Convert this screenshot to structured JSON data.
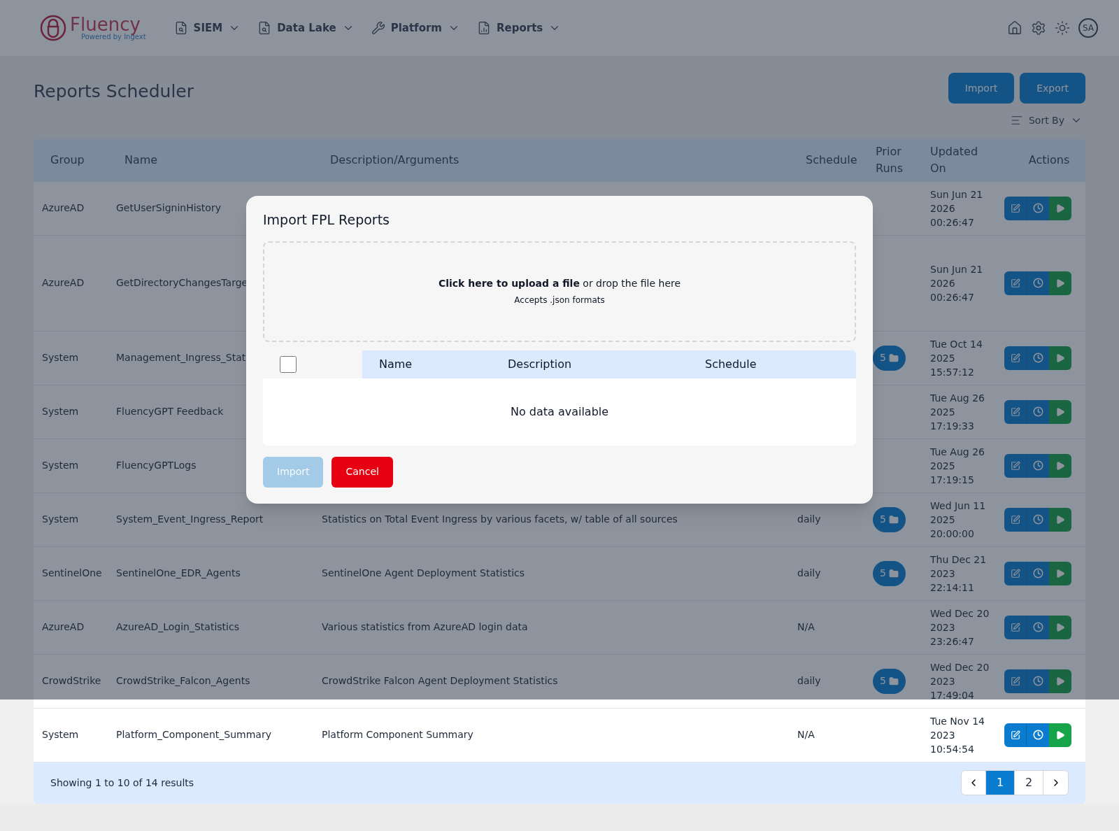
{
  "nav": {
    "logo": "Fluency",
    "logo_tagline": "Powered by Ingext",
    "menus": [
      {
        "label": "SIEM",
        "kind": "search"
      },
      {
        "label": "Data Lake",
        "kind": "search"
      },
      {
        "label": "Platform",
        "kind": "tool"
      },
      {
        "label": "Reports",
        "kind": "report"
      }
    ],
    "avatar": "SA"
  },
  "page": {
    "title": "Reports Scheduler",
    "buttons": [
      "Import",
      "Export"
    ],
    "sort": "Sort By"
  },
  "table": {
    "columns": [
      "Group",
      "Name",
      "Description/Arguments",
      "Schedule",
      "Prior Runs",
      "Updated On",
      "Actions"
    ],
    "rows": [
      {
        "group": "AzureAD",
        "name": "GetUserSigninHistory",
        "updated": "Sun Jun 21 2026 00:26:47"
      },
      {
        "group": "AzureAD",
        "name": "GetDirectoryChangesTarge",
        "updated": "Sun Jun 21 2026 00:26:47"
      },
      {
        "group": "System",
        "name": "Management_Ingress_Stat",
        "prior_runs": "5",
        "updated": "Tue Oct 14 2025 15:57:12"
      },
      {
        "group": "System",
        "name": "FluencyGPT Feedback",
        "updated": "Tue Aug 26 2025 17:19:33"
      },
      {
        "group": "System",
        "name": "FluencyGPTLogs",
        "updated": "Tue Aug 26 2025 17:19:15"
      },
      {
        "group": "System",
        "name": "System_Event_Ingress_Report",
        "description": "Statistics on Total Event Ingress by various facets, w/ table of all sources",
        "schedule": "daily",
        "prior_runs": "5",
        "updated": "Wed Jun 11 2025 20:00:00"
      },
      {
        "group": "SentinelOne",
        "name": "SentinelOne_EDR_Agents",
        "description": "SentinelOne Agent Deployment Statistics",
        "schedule": "daily",
        "prior_runs": "5",
        "updated": "Thu Dec 21 2023 22:14:11"
      },
      {
        "group": "AzureAD",
        "name": "AzureAD_Login_Statistics",
        "description": "Various statistics from AzureAD login data",
        "schedule": "N/A",
        "updated": "Wed Dec 20 2023 23:26:47"
      },
      {
        "group": "CrowdStrike",
        "name": "CrowdStrike_Falcon_Agents",
        "description": "CrowdStrike Falcon Agent Deployment Statistics",
        "schedule": "daily",
        "prior_runs": "5",
        "updated": "Wed Dec 20 2023 17:49:04"
      },
      {
        "group": "System",
        "name": "Platform_Component_Summary",
        "description": "Platform Component Summary",
        "schedule": "N/A",
        "updated": "Tue Nov 14 2023 10:54:54"
      }
    ]
  },
  "footer": {
    "summary": "Showing 1 to 10 of 14 results",
    "pages": [
      {
        "label": "1",
        "selected": true
      },
      {
        "label": "2",
        "selected": false
      }
    ]
  },
  "dialog": {
    "title": "Import FPL Reports",
    "upload": "**Click here to upload a file** or drop the file here",
    "accepts": "Accepts .json formats",
    "select_all_checked": false,
    "columns": [
      "Name",
      "Description",
      "Schedule"
    ],
    "empty": "No data available",
    "buttons": [
      {
        "label": "Import",
        "kind": "primary",
        "disabled": true
      },
      {
        "label": "Cancel",
        "kind": "danger",
        "disabled": false
      }
    ]
  }
}
